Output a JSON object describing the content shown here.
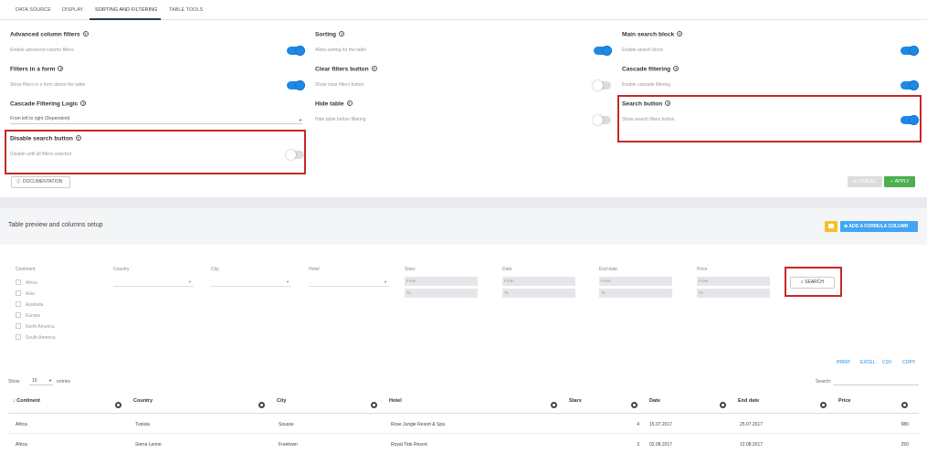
{
  "tabs": [
    {
      "label": "DATA SOURCE"
    },
    {
      "label": "DISPLAY"
    },
    {
      "label": "SORTING AND FILTERING"
    },
    {
      "label": "TABLE TOOLS"
    }
  ],
  "settings": {
    "advanced_filters": {
      "title": "Advanced column filters",
      "desc": "Enable advanced column filters",
      "on": true
    },
    "filters_form": {
      "title": "Filters in a form",
      "desc": "Show filters in a form above the table",
      "on": true
    },
    "cascade_logic": {
      "title": "Cascade Filtering Logic",
      "value": "From left to right (Dependent)"
    },
    "disable_search": {
      "title": "Disable search button",
      "desc": "Disable until all filters selected",
      "on": false
    },
    "sorting": {
      "title": "Sorting",
      "desc": "Allow sorting for the table",
      "on": true
    },
    "clear_filters": {
      "title": "Clear filters button",
      "desc": "Show clear filters button",
      "on": false
    },
    "hide_table": {
      "title": "Hide table",
      "desc": "Hide table before filtering",
      "on": false
    },
    "main_search": {
      "title": "Main search block",
      "desc": "Enable search block",
      "on": true
    },
    "cascade_filtering": {
      "title": "Cascade filtering",
      "desc": "Enable cascade filtering",
      "on": true
    },
    "search_button": {
      "title": "Search button",
      "desc": "Show search filters button",
      "on": true
    }
  },
  "buttons": {
    "documentation": "DOCUMENTATION",
    "cancel": "CANCEL",
    "apply": "APPLY",
    "add_formula": "ADD A FORMULA COLUMN",
    "search": "SEARCH"
  },
  "preview": {
    "title": "Table preview and columns setup"
  },
  "filters": {
    "continent_label": "Continent",
    "continents": [
      "Africa",
      "Asia",
      "Australia",
      "Europe",
      "North America",
      "South America"
    ],
    "country_label": "Country",
    "city_label": "City",
    "hotel_label": "Hotel",
    "stars_label": "Stars",
    "date_label": "Date",
    "end_date_label": "End date",
    "price_label": "Price",
    "from": "From",
    "to": "To"
  },
  "export": [
    "PRINT",
    "EXCEL",
    "CSV",
    "COPY"
  ],
  "table_controls": {
    "show": "Show",
    "entries_value": "10",
    "entries": "entries",
    "search": "Search:"
  },
  "columns": [
    "Continent",
    "Country",
    "City",
    "Hotel",
    "Stars",
    "Date",
    "End date",
    "Price"
  ],
  "rows": [
    [
      "Africa",
      "Tunisia",
      "Sousse",
      "Rose Jungle Resort & Spa",
      "4",
      "15.07.2017",
      "25.07.2017",
      "980"
    ],
    [
      "Africa",
      "Sierra Leone",
      "Freetown",
      "Royal Tide Resort",
      "3",
      "02.08.2017",
      "12.08.2017",
      "250"
    ]
  ],
  "colors": {
    "accent": "#1e88e5",
    "highlight": "#c62828",
    "apply": "#4caf50",
    "formula": "#42a5f5",
    "yellow": "#f5c02b"
  }
}
